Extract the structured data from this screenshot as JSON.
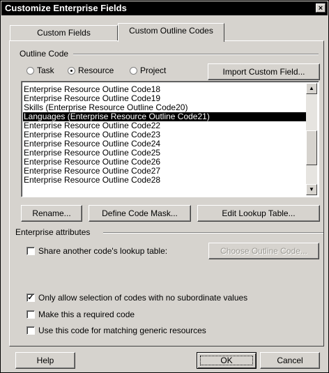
{
  "window": {
    "title": "Customize Enterprise Fields",
    "close_glyph": "×"
  },
  "tabs": [
    {
      "label": "Custom Fields",
      "active": false
    },
    {
      "label": "Custom Outline Codes",
      "active": true
    }
  ],
  "outline_code": {
    "group_label": "Outline Code",
    "radios": [
      {
        "label": "Task",
        "selected": false
      },
      {
        "label": "Resource",
        "selected": true
      },
      {
        "label": "Project",
        "selected": false
      }
    ],
    "import_button": "Import Custom Field..."
  },
  "code_list": {
    "items": [
      "Enterprise Resource Outline Code18",
      "Enterprise Resource Outline Code19",
      "Skills (Enterprise Resource Outline Code20)",
      "Languages (Enterprise Resource Outline Code21)",
      "Enterprise Resource Outline Code22",
      "Enterprise Resource Outline Code23",
      "Enterprise Resource Outline Code24",
      "Enterprise Resource Outline Code25",
      "Enterprise Resource Outline Code26",
      "Enterprise Resource Outline Code27",
      "Enterprise Resource Outline Code28"
    ],
    "selected_item": "Languages (Enterprise Resource Outline Code21)",
    "scroll_up_glyph": "▲",
    "scroll_down_glyph": "▼"
  },
  "actions": {
    "rename": "Rename...",
    "define_code_mask": "Define Code Mask...",
    "edit_lookup_table": "Edit Lookup Table..."
  },
  "enterprise_attributes": {
    "group_label": "Enterprise attributes",
    "share_lookup": {
      "label": "Share another code's lookup table:",
      "checked": false
    },
    "choose_outline_code": "Choose Outline Code..."
  },
  "options": {
    "only_allow_no_subordinate": {
      "label": "Only allow selection of codes with no subordinate values",
      "checked": true
    },
    "required_code": {
      "label": "Make this a required code",
      "checked": false
    },
    "generic_matching": {
      "label": "Use this code for matching generic resources",
      "checked": false
    }
  },
  "check_glyph": "✓",
  "footer": {
    "help": "Help",
    "ok": "OK",
    "cancel": "Cancel"
  }
}
